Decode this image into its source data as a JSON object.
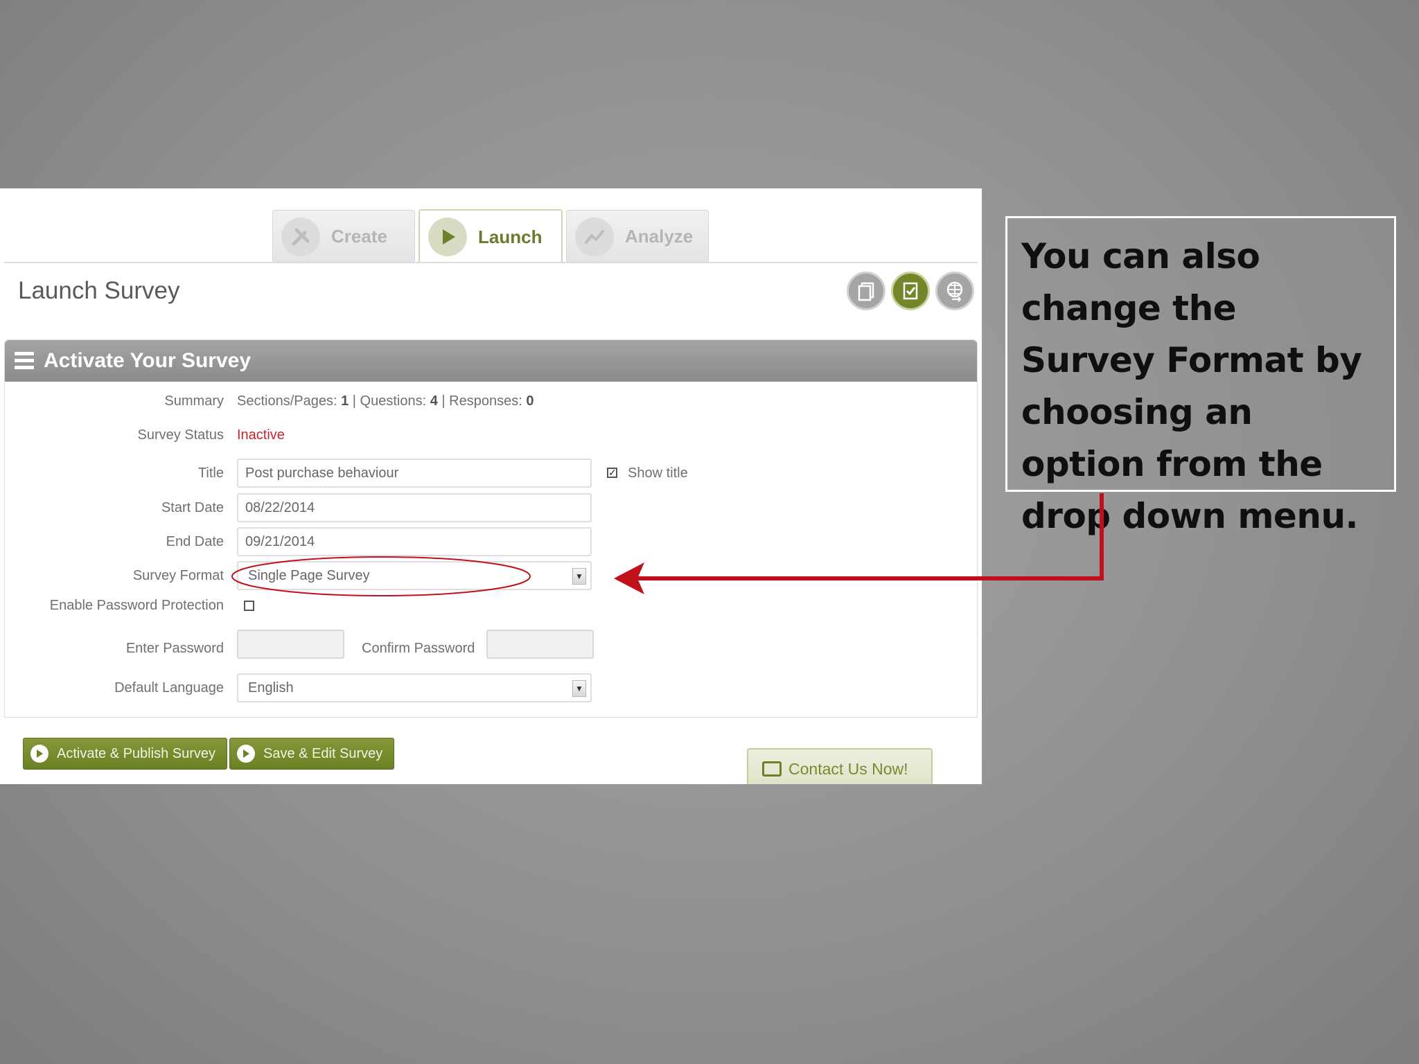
{
  "tabs": [
    {
      "label": "Create",
      "icon": "tools-icon",
      "active": false
    },
    {
      "label": "Launch",
      "icon": "play-icon",
      "active": true
    },
    {
      "label": "Analyze",
      "icon": "chart-line-icon",
      "active": false
    }
  ],
  "page_title": "Launch Survey",
  "toolbar_icons": [
    "copy-icon",
    "check-document-icon",
    "globe-icon"
  ],
  "panel": {
    "title": "Activate Your Survey",
    "summary_label": "Summary",
    "summary": {
      "sections_label": "Sections/Pages:",
      "sections": "1",
      "questions_label": "Questions:",
      "questions": "4",
      "responses_label": "Responses:",
      "responses": "0",
      "separator": "|"
    },
    "status_label": "Survey Status",
    "status_value": "Inactive",
    "title_label": "Title",
    "title_value": "Post purchase behaviour",
    "show_title_label": "Show title",
    "show_title_checked": true,
    "start_date_label": "Start Date",
    "start_date_value": "08/22/2014",
    "end_date_label": "End Date",
    "end_date_value": "09/21/2014",
    "format_label": "Survey Format",
    "format_value": "Single Page Survey",
    "password_protection_label": "Enable Password Protection",
    "password_protection_checked": false,
    "enter_password_label": "Enter Password",
    "confirm_password_label": "Confirm Password",
    "language_label": "Default Language",
    "language_value": "English"
  },
  "buttons": {
    "activate": "Activate & Publish Survey",
    "save_edit": "Save & Edit Survey",
    "contact": "Contact Us Now!"
  },
  "callout_text": "You can also change the Survey Format by choosing an option from the drop down menu.",
  "colors": {
    "accent_green": "#74862a",
    "status_red": "#c8242b",
    "annotation_red": "#c0111a",
    "panel_header": "#999999"
  }
}
